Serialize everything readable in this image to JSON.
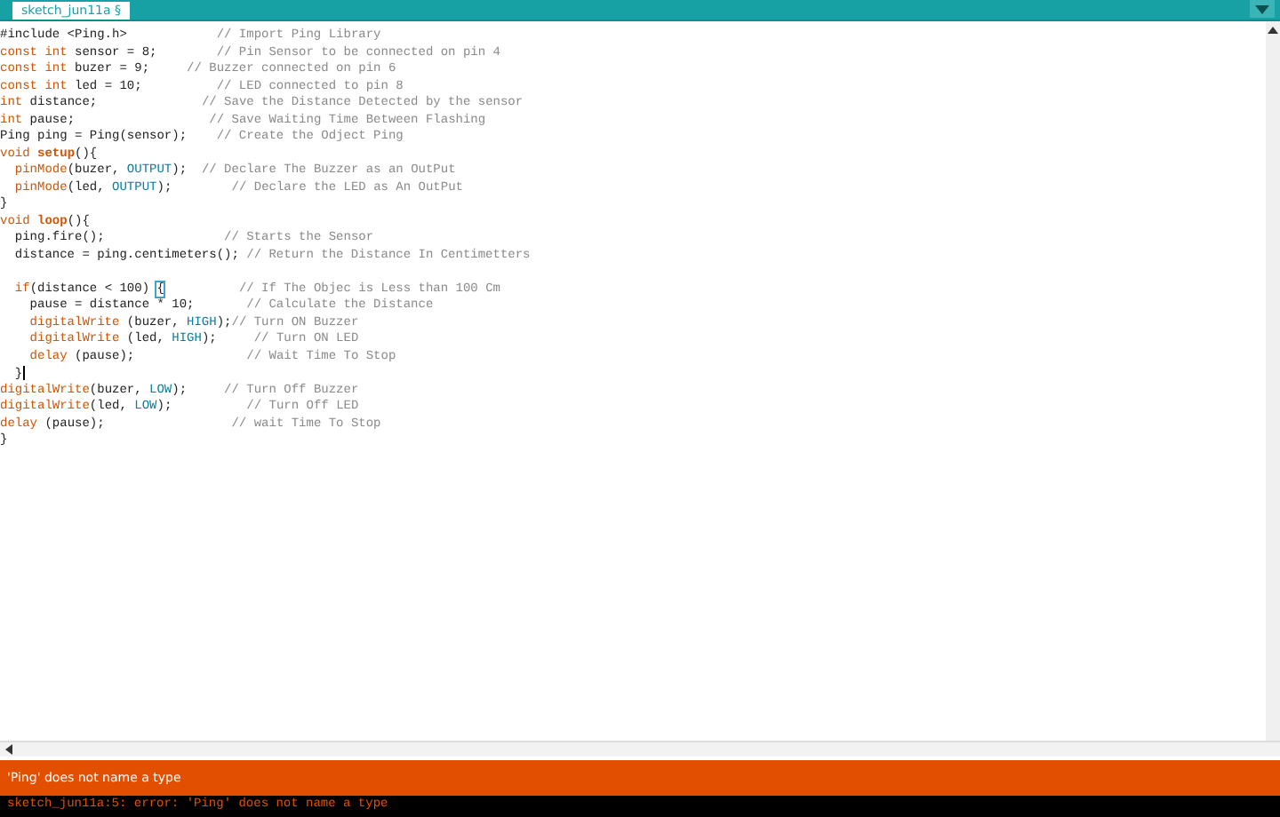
{
  "tabs": [
    {
      "label": "sketch_jun11a §",
      "selected": true
    }
  ],
  "editor": {
    "lines": [
      {
        "segments": [
          {
            "kind": "plain",
            "text": "#include <Ping.h>            "
          },
          {
            "kind": "comment",
            "text": "// Import Ping Library"
          }
        ]
      },
      {
        "segments": [
          {
            "kind": "keyword",
            "text": "const int"
          },
          {
            "kind": "plain",
            "text": " sensor = 8;        "
          },
          {
            "kind": "comment",
            "text": "// Pin Sensor to be connected on pin 4"
          }
        ]
      },
      {
        "segments": [
          {
            "kind": "keyword",
            "text": "const int"
          },
          {
            "kind": "plain",
            "text": " buzer = 9;     "
          },
          {
            "kind": "comment",
            "text": "// Buzzer connected on pin 6"
          }
        ]
      },
      {
        "segments": [
          {
            "kind": "keyword",
            "text": "const int"
          },
          {
            "kind": "plain",
            "text": " led = 10;          "
          },
          {
            "kind": "comment",
            "text": "// LED connected to pin 8"
          }
        ]
      },
      {
        "segments": [
          {
            "kind": "keyword",
            "text": "int"
          },
          {
            "kind": "plain",
            "text": " distance;              "
          },
          {
            "kind": "comment",
            "text": "// Save the Distance Detected by the sensor"
          }
        ]
      },
      {
        "segments": [
          {
            "kind": "keyword",
            "text": "int"
          },
          {
            "kind": "plain",
            "text": " pause;                  "
          },
          {
            "kind": "comment",
            "text": "// Save Waiting Time Between Flashing"
          }
        ]
      },
      {
        "segments": [
          {
            "kind": "plain",
            "text": "Ping ping = Ping(sensor);    "
          },
          {
            "kind": "comment",
            "text": "// Create the Odject Ping"
          }
        ]
      },
      {
        "segments": [
          {
            "kind": "keyword",
            "text": "void"
          },
          {
            "kind": "function",
            "text": " setup"
          },
          {
            "kind": "plain",
            "text": "(){"
          }
        ]
      },
      {
        "segments": [
          {
            "kind": "keyword",
            "text": "  pinMode"
          },
          {
            "kind": "plain",
            "text": "(buzer, "
          },
          {
            "kind": "constant",
            "text": "OUTPUT"
          },
          {
            "kind": "plain",
            "text": ");  "
          },
          {
            "kind": "comment",
            "text": "// Declare The Buzzer as an OutPut"
          }
        ]
      },
      {
        "segments": [
          {
            "kind": "keyword",
            "text": "  pinMode"
          },
          {
            "kind": "plain",
            "text": "(led, "
          },
          {
            "kind": "constant",
            "text": "OUTPUT"
          },
          {
            "kind": "plain",
            "text": ");        "
          },
          {
            "kind": "comment",
            "text": "// Declare the LED as An OutPut"
          }
        ]
      },
      {
        "segments": [
          {
            "kind": "plain",
            "text": "}"
          }
        ]
      },
      {
        "segments": [
          {
            "kind": "keyword",
            "text": "void"
          },
          {
            "kind": "function",
            "text": " loop"
          },
          {
            "kind": "plain",
            "text": "(){"
          }
        ]
      },
      {
        "segments": [
          {
            "kind": "plain",
            "text": "  ping.fire();                "
          },
          {
            "kind": "comment",
            "text": "// Starts the Sensor"
          }
        ]
      },
      {
        "segments": [
          {
            "kind": "plain",
            "text": "  distance = ping.centimeters(); "
          },
          {
            "kind": "comment",
            "text": "// Return the Distance In Centimetters"
          }
        ]
      },
      {
        "blank": true
      },
      {
        "segments": [
          {
            "kind": "keyword",
            "text": "  if"
          },
          {
            "kind": "plain",
            "text": "(distance < 100) "
          },
          {
            "kind": "match",
            "text": "{"
          },
          {
            "kind": "comment",
            "text": "          // If The Objec is Less than 100 Cm"
          }
        ]
      },
      {
        "segments": [
          {
            "kind": "plain",
            "text": "    pause = distance * 10;       "
          },
          {
            "kind": "comment",
            "text": "// Calculate the Distance"
          }
        ]
      },
      {
        "segments": [
          {
            "kind": "keyword",
            "text": "    digitalWrite"
          },
          {
            "kind": "plain",
            "text": " (buzer, "
          },
          {
            "kind": "constant",
            "text": "HIGH"
          },
          {
            "kind": "plain",
            "text": ");"
          },
          {
            "kind": "comment",
            "text": "// Turn ON Buzzer"
          }
        ]
      },
      {
        "segments": [
          {
            "kind": "keyword",
            "text": "    digitalWrite"
          },
          {
            "kind": "plain",
            "text": " (led, "
          },
          {
            "kind": "constant",
            "text": "HIGH"
          },
          {
            "kind": "plain",
            "text": ");     "
          },
          {
            "kind": "comment",
            "text": "// Turn ON LED"
          }
        ]
      },
      {
        "segments": [
          {
            "kind": "keyword",
            "text": "    delay"
          },
          {
            "kind": "plain",
            "text": " (pause);               "
          },
          {
            "kind": "comment",
            "text": "// Wait Time To Stop"
          }
        ]
      },
      {
        "segments": [
          {
            "kind": "plain",
            "text": "  }"
          }
        ],
        "cursor": true
      },
      {
        "segments": [
          {
            "kind": "keyword",
            "text": "digitalWrite"
          },
          {
            "kind": "plain",
            "text": "(buzer, "
          },
          {
            "kind": "constant",
            "text": "LOW"
          },
          {
            "kind": "plain",
            "text": ");     "
          },
          {
            "kind": "comment",
            "text": "// Turn Off Buzzer"
          }
        ]
      },
      {
        "segments": [
          {
            "kind": "keyword",
            "text": "digitalWrite"
          },
          {
            "kind": "plain",
            "text": "(led, "
          },
          {
            "kind": "constant",
            "text": "LOW"
          },
          {
            "kind": "plain",
            "text": ");          "
          },
          {
            "kind": "comment",
            "text": "// Turn Off LED"
          }
        ]
      },
      {
        "segments": [
          {
            "kind": "keyword",
            "text": "delay"
          },
          {
            "kind": "plain",
            "text": " (pause);                 "
          },
          {
            "kind": "comment",
            "text": "// wait Time To Stop"
          }
        ]
      },
      {
        "segments": [
          {
            "kind": "plain",
            "text": "}"
          }
        ]
      }
    ]
  },
  "status_bar": {
    "message": "'Ping' does not name a type"
  },
  "console": {
    "lines": [
      "sketch_jun11a:5: error: 'Ping' does not name a type"
    ]
  }
}
